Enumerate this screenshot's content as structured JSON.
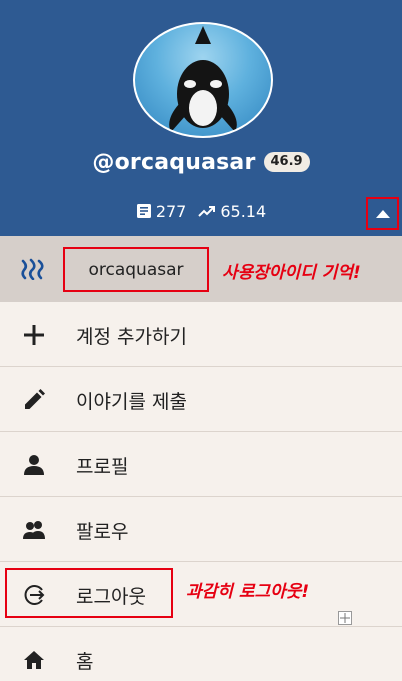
{
  "profile": {
    "username": "@orcaquasar",
    "reputation": "46.9",
    "posts_count": "277",
    "steem_power": "65.14"
  },
  "account": {
    "name": "orcaquasar"
  },
  "menu": [
    {
      "label": "계정 추가하기",
      "icon": "plus-icon"
    },
    {
      "label": "이야기를 제출",
      "icon": "pencil-icon"
    },
    {
      "label": "프로필",
      "icon": "person-icon"
    },
    {
      "label": "팔로우",
      "icon": "people-icon"
    },
    {
      "label": "로그아웃",
      "icon": "logout-icon"
    },
    {
      "label": "홈",
      "icon": "home-icon"
    }
  ],
  "annotations": {
    "account_note": "사용장아이디 기억!",
    "logout_note": "과감히 로그아웃!"
  },
  "colors": {
    "header_bg": "#2e5a92",
    "account_row_bg": "#d6cfca",
    "menu_bg": "#f6f1ec",
    "annotation_red": "#e60012"
  }
}
